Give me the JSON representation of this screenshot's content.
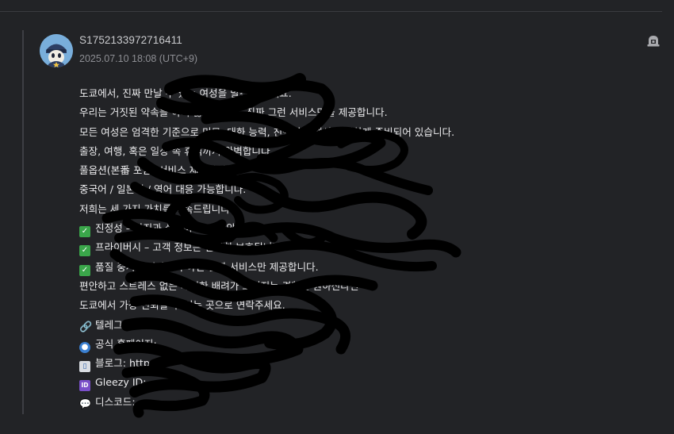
{
  "post": {
    "username": "S1752133972716411",
    "timestamp": "2025.07.10 18:08 (UTC+9)",
    "report_icon": "report-icon",
    "lines": [
      {
        "icon": "",
        "text": "도쿄에서, 진짜 만날 수 있는 여성을 발견해 보세요."
      },
      {
        "icon": "",
        "text": "우리는 거짓된 약속을 하지 않습니다 — 진짜 그런 서비스만을 제공합니다."
      },
      {
        "icon": "",
        "text": "모든 여성은 엄격한 기준으로 미모, 대화 능력, 친절성 면에서 완벽하게 준비되어 있습니다."
      },
      {
        "icon": "",
        "text": "출장, 여행, 혹은 일상 속 휴식까지 완벽합니다"
      },
      {
        "icon": "",
        "text": "풀옵션(본番 포함) 서비스 제공합니다"
      },
      {
        "icon": "",
        "text": "중국어 / 일본어 / 영어 대응 가능합니다."
      },
      {
        "icon": "",
        "text": "저희는 세 가지 가치를 약속드립니다."
      },
      {
        "icon": "check",
        "text": "진정성 – 사진과 실물이 다르지 않습니다."
      },
      {
        "icon": "check",
        "text": "프라이버시 – 고객 정보는 철저히 보호됩니다."
      },
      {
        "icon": "check",
        "text": "품질 중시 – 저가형이 아닌 진짜 서비스만 제공합니다."
      },
      {
        "icon": "",
        "text": "편안하고 스트레스 없는 세심한 배려가 느껴지는 경험을 원하신다면"
      },
      {
        "icon": "",
        "text": "도쿄에서 가장 신뢰할 수 있는 곳으로 연락주세요."
      },
      {
        "icon": "link",
        "text": "텔레그램:"
      },
      {
        "icon": "globe",
        "text": "공식 홈페이지:"
      },
      {
        "icon": "book",
        "text": "블로그: https://"
      },
      {
        "icon": "id",
        "text": "Gleezy ID:"
      },
      {
        "icon": "speech",
        "text": "디스코드: "
      }
    ]
  },
  "icons": {
    "check": "white-check-mark-icon",
    "link": "link-icon",
    "globe": "globe-icon",
    "book": "open-book-icon",
    "id": "id-button-icon",
    "speech": "speech-balloon-icon"
  },
  "colors": {
    "background": "#222326",
    "text": "#ececee",
    "meta": "#8d8e93",
    "scribble": "#000000"
  }
}
